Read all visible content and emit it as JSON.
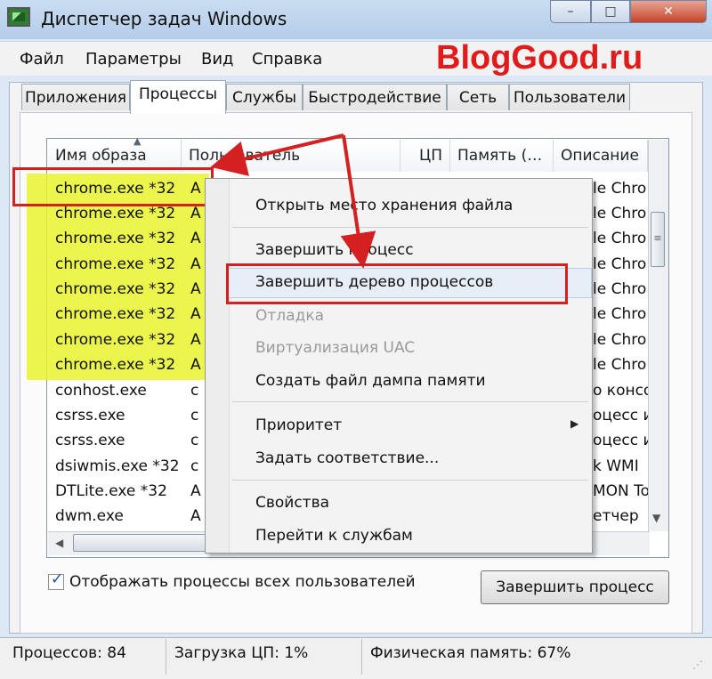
{
  "window": {
    "title": "Диспетчер задач Windows",
    "controls": {
      "minimize": "–",
      "maximize": "□",
      "close": "✕"
    }
  },
  "watermark": "BlogGood.ru",
  "menubar": [
    "Файл",
    "Параметры",
    "Вид",
    "Справка"
  ],
  "tabs": [
    "Приложения",
    "Процессы",
    "Службы",
    "Быстродействие",
    "Сеть",
    "Пользователи"
  ],
  "active_tab": "Процессы",
  "columns": [
    "Имя образа",
    "Пользователь",
    "ЦП",
    "Память (…",
    "Описание"
  ],
  "rows": [
    {
      "name": "chrome.exe *32",
      "user": "A",
      "desc": "le Chro"
    },
    {
      "name": "chrome.exe *32",
      "user": "A",
      "desc": "le Chro"
    },
    {
      "name": "chrome.exe *32",
      "user": "A",
      "desc": "le Chro"
    },
    {
      "name": "chrome.exe *32",
      "user": "A",
      "desc": "le Chro"
    },
    {
      "name": "chrome.exe *32",
      "user": "A",
      "desc": "le Chro"
    },
    {
      "name": "chrome.exe *32",
      "user": "A",
      "desc": "le Chro"
    },
    {
      "name": "chrome.exe *32",
      "user": "A",
      "desc": "le Chro"
    },
    {
      "name": "chrome.exe *32",
      "user": "A",
      "desc": "le Chro"
    },
    {
      "name": "conhost.exe",
      "user": "c",
      "desc": "о консо"
    },
    {
      "name": "csrss.exe",
      "user": "c",
      "desc": "оцесс ис"
    },
    {
      "name": "csrss.exe",
      "user": "c",
      "desc": "оцесс ис"
    },
    {
      "name": "dsiwmis.exe *32",
      "user": "c",
      "desc": "k WMI"
    },
    {
      "name": "DTLite.exe *32",
      "user": "A",
      "desc": "MON To"
    },
    {
      "name": "dwm.exe",
      "user": "A",
      "desc": "етчер"
    }
  ],
  "context_menu": [
    {
      "label": "Открыть место хранения файла",
      "disabled": false
    },
    {
      "label": "Завершить процесс",
      "disabled": false
    },
    {
      "label": "Завершить дерево процессов",
      "disabled": false
    },
    {
      "label": "Отладка",
      "disabled": true
    },
    {
      "label": "Виртуализация UAC",
      "disabled": true
    },
    {
      "label": "Создать файл дампа памяти",
      "disabled": false
    },
    {
      "label": "Приоритет",
      "disabled": false
    },
    {
      "label": "Задать соответствие...",
      "disabled": false
    },
    {
      "label": "Свойства",
      "disabled": false
    },
    {
      "label": "Перейти к службам",
      "disabled": false
    }
  ],
  "show_all_users": {
    "label": "Отображать процессы всех пользователей",
    "checked": true
  },
  "end_process_button": "Завершить процесс",
  "status": {
    "processes": "Процессов: 84",
    "cpu": "Загрузка ЦП: 1%",
    "memory": "Физическая память: 67%"
  },
  "colors": {
    "annotation_red": "#d42020",
    "highlight_yellow": "#e8f32b",
    "watermark_red": "#e11b1b"
  }
}
